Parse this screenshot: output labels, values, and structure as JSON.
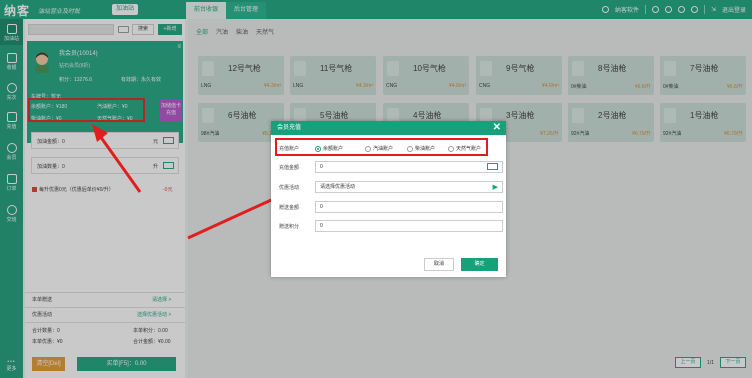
{
  "app": {
    "logo": "纳客",
    "slogan": "油站营业及时批",
    "branch_label": "加油站"
  },
  "top_tabs": [
    {
      "label": "前台收银"
    },
    {
      "label": "后台管理"
    }
  ],
  "top_right": {
    "user": "纳客软件",
    "logout": "退出登录"
  },
  "sidebar": [
    {
      "label": "加油站"
    },
    {
      "label": "收银"
    },
    {
      "label": "充次"
    },
    {
      "label": "充值"
    },
    {
      "label": "会员"
    },
    {
      "label": "订单"
    },
    {
      "label": "交班"
    },
    {
      "label": "更多"
    }
  ],
  "left": {
    "search_button": "搜索",
    "add_button": "+新增",
    "member": {
      "name": "我会员(10014)",
      "level": "钻石会员(8折)",
      "points_label": "积分：13276.6",
      "valid_label": "有效期：永久有效",
      "plate_label": "车牌号：暂无",
      "balance_label": "余额账户：¥180",
      "gas_label": "汽油账户：¥0",
      "diesel_label": "柴油账户：¥0",
      "natural_gas_label": "天然气账户：¥0",
      "recharge_button": "加储值卡充值"
    },
    "fuel_amount_label": "加油金额：0",
    "fuel_amount_unit": "元",
    "fuel_qty_label": "加油数量：0",
    "fuel_qty_unit": "升",
    "promo_text": "每升优惠0元（优惠后单价¥0/升）",
    "promo_value": "-0元",
    "summary": {
      "coupon_label": "本单赠送",
      "coupon_link": "请选择 >",
      "activity_label": "优惠活动",
      "activity_link": "选择优惠活动 >",
      "count_label": "合计数量：0",
      "points_label": "本单积分：0.00",
      "discount_label": "本单优惠：¥0",
      "total_label": "合计金额：¥0.00"
    },
    "clear_button": "清空[Del]",
    "pay_button": "买单[F5]：0.00"
  },
  "main": {
    "filters": [
      {
        "label": "全部"
      },
      {
        "label": "汽油"
      },
      {
        "label": "柴油"
      },
      {
        "label": "天然气"
      }
    ],
    "row1": [
      {
        "name": "12号气枪",
        "fuel": "LNG",
        "price": "¥4.3/m³"
      },
      {
        "name": "11号气枪",
        "fuel": "LNG",
        "price": "¥4.3/m³"
      },
      {
        "name": "10号气枪",
        "fuel": "CNG",
        "price": "¥4.6/m³"
      },
      {
        "name": "9号气枪",
        "fuel": "CNG",
        "price": "¥4.6/m³"
      },
      {
        "name": "8号油枪",
        "fuel": "0#柴油",
        "price": "¥6.6/升"
      },
      {
        "name": "7号油枪",
        "fuel": "0#柴油",
        "price": "¥6.6/升"
      }
    ],
    "row2": [
      {
        "name": "6号油枪",
        "fuel": "98#汽油",
        "price": "¥8.16/升"
      },
      {
        "name": "5号油枪",
        "fuel": "",
        "price": ""
      },
      {
        "name": "4号油枪",
        "fuel": "",
        "price": ""
      },
      {
        "name": "3号油枪",
        "fuel": "",
        "price": "¥7.26/升"
      },
      {
        "name": "2号油枪",
        "fuel": "92#汽油",
        "price": "¥6.79/升"
      },
      {
        "name": "1号油枪",
        "fuel": "92#汽油",
        "price": "¥6.79/升"
      }
    ],
    "pager": {
      "prev": "上一页",
      "page": "1/1",
      "next": "下一页"
    }
  },
  "dialog": {
    "title": "会员充值",
    "account_label": "充值账户",
    "accounts": [
      {
        "label": "余额账户",
        "checked": true
      },
      {
        "label": "汽油账户",
        "checked": false
      },
      {
        "label": "柴油账户",
        "checked": false
      },
      {
        "label": "天然气账户",
        "checked": false
      }
    ],
    "amount_label": "充值金额",
    "amount_value": "0",
    "offer_label": "优惠活动",
    "offer_placeholder": "请选择优惠活动",
    "gift_label": "赠送金额",
    "gift_value": "0",
    "points_label": "赠送积分",
    "points_value": "0",
    "cancel_button": "取消",
    "ok_button": "确定"
  },
  "colors": {
    "brand": "#15a27a",
    "highlight": "#e01e1e",
    "accent_orange": "#e2962c"
  }
}
